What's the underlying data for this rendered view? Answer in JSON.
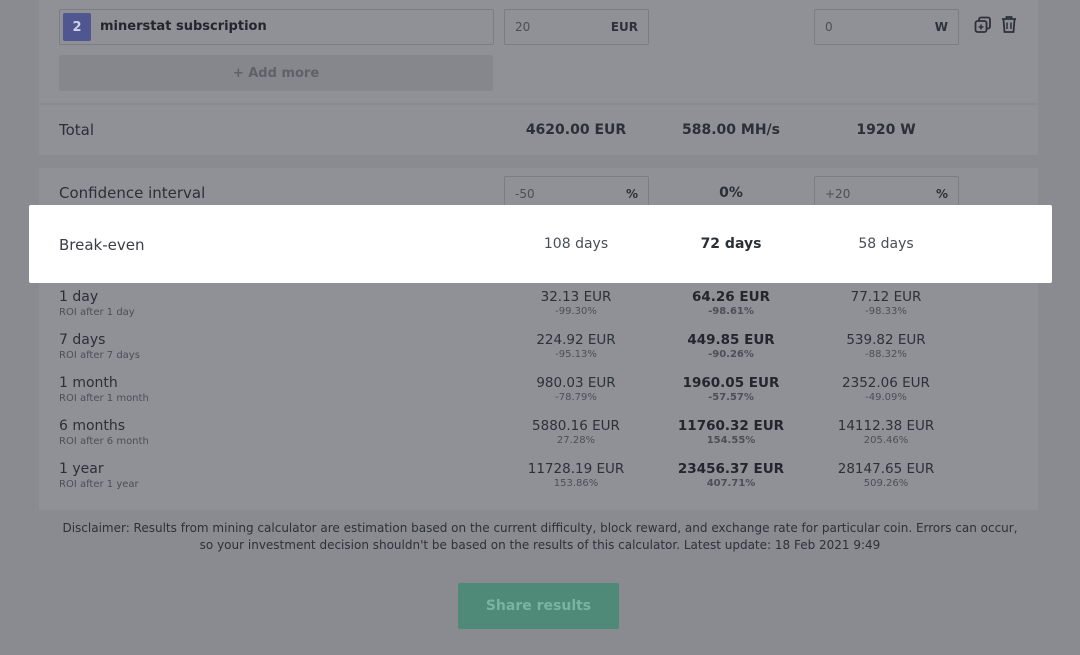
{
  "item": {
    "index": "2",
    "name": "minerstat subscription",
    "cost_value": "20",
    "cost_unit": "EUR",
    "power_value": "0",
    "power_unit": "W"
  },
  "add_more_label": "+ Add more",
  "total": {
    "label": "Total",
    "cost": "4620.00 EUR",
    "hashrate": "588.00 MH/s",
    "power": "1920 W"
  },
  "confidence": {
    "label": "Confidence interval",
    "low_value": "-50",
    "low_unit": "%",
    "mid": "0%",
    "high_value": "+20",
    "high_unit": "%"
  },
  "break_even": {
    "label": "Break-even",
    "low": "108 days",
    "mid": "72 days",
    "high": "58 days"
  },
  "profit_rows": [
    {
      "label": "1 day",
      "sub": "ROI after 1 day",
      "low": "32.13 EUR",
      "low_pct": "-99.30%",
      "mid": "64.26 EUR",
      "mid_pct": "-98.61%",
      "high": "77.12 EUR",
      "high_pct": "-98.33%"
    },
    {
      "label": "7 days",
      "sub": "ROI after 7 days",
      "low": "224.92 EUR",
      "low_pct": "-95.13%",
      "mid": "449.85 EUR",
      "mid_pct": "-90.26%",
      "high": "539.82 EUR",
      "high_pct": "-88.32%"
    },
    {
      "label": "1 month",
      "sub": "ROI after 1 month",
      "low": "980.03 EUR",
      "low_pct": "-78.79%",
      "mid": "1960.05 EUR",
      "mid_pct": "-57.57%",
      "high": "2352.06 EUR",
      "high_pct": "-49.09%"
    },
    {
      "label": "6 months",
      "sub": "ROI after 6 month",
      "low": "5880.16 EUR",
      "low_pct": "27.28%",
      "mid": "11760.32 EUR",
      "mid_pct": "154.55%",
      "high": "14112.38 EUR",
      "high_pct": "205.46%"
    },
    {
      "label": "1 year",
      "sub": "ROI after 1 year",
      "low": "11728.19 EUR",
      "low_pct": "153.86%",
      "mid": "23456.37 EUR",
      "mid_pct": "407.71%",
      "high": "28147.65 EUR",
      "high_pct": "509.26%"
    }
  ],
  "disclaimer": "Disclaimer: Results from mining calculator are estimation based on the current difficulty, block reward, and exchange rate for particular coin. Errors can occur, so your investment decision shouldn't be based on the results of this calculator. Latest update: 18 Feb 2021 9:49",
  "share_label": "Share results",
  "icons": [
    "duplicate-icon",
    "trash-icon"
  ]
}
